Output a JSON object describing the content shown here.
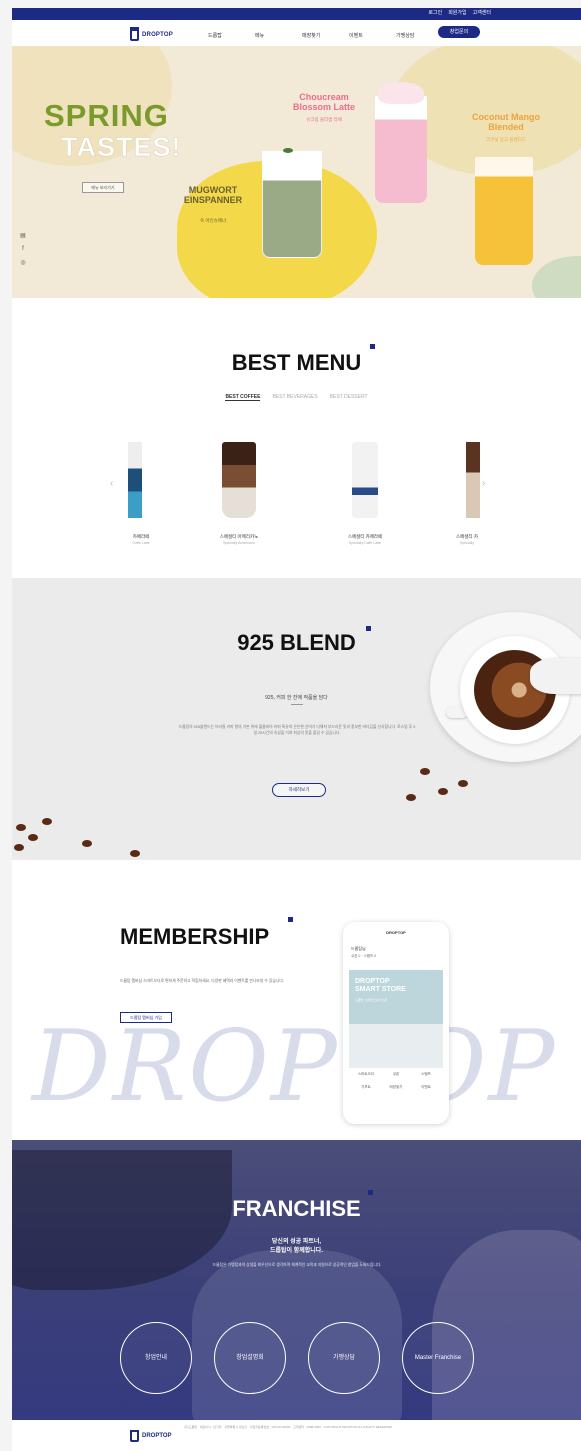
{
  "util": {
    "links": [
      "로그인",
      "회원가입",
      "고객센터"
    ]
  },
  "header": {
    "logo": "DROPTOP",
    "nav": [
      "드롭탑",
      "메뉴",
      "매장찾기",
      "이벤트",
      "가맹상담"
    ],
    "cta": "창업문의"
  },
  "hero": {
    "title1": "SPRING",
    "title2": "TASTES!",
    "more": "메뉴 보러가기",
    "drink1_name": "Choucream Blossom Latte",
    "drink1_sub": "슈크림 블라썸 라떼",
    "drink2_name": "Coconut Mango Blended",
    "drink2_sub": "코코넛 망고 블렌디드",
    "drink3_name": "MUGWORT EINSPANNER",
    "drink3_sub": "쑥 아인슈페너"
  },
  "social": [
    "blog-icon",
    "facebook-icon",
    "instagram-icon"
  ],
  "best_menu": {
    "title": "BEST MENU",
    "tabs": [
      "BEST COFFEE",
      "BEST BEVERAGES",
      "BEST DESSERT"
    ],
    "products": [
      {
        "name": "카페라떼",
        "en": "Caffe Latte"
      },
      {
        "name": "스페셜티 아메리카노",
        "en": "Specialty Americano"
      },
      {
        "name": "스페셜티 카페라떼",
        "en": "Specialty Caffe Latte"
      },
      {
        "name": "스페셜티 카",
        "en": "Specialty"
      }
    ]
  },
  "blend": {
    "title": "925 BLEND",
    "subtitle": "925, 커피 한 잔에 작품을 담다",
    "body": "드롭탑의 925블렌드는 브라질 커피 향의 기본 위에 콜롬비아 커피 특유의 은은한 산미가 더해져 부드러운 맛과 풍부한 바디감을 선사합니다. 로스팅 후 9일 25시간의 숙성을 거쳐 최상의 맛을 즐길 수 있습니다.",
    "button": "자세히보기"
  },
  "membership": {
    "title": "MEMBERSHIP",
    "body": "드롭탑 멤버십 스마트오더로 편하게 주문하고 적립하세요. 다양한 혜택과 이벤트를 만나보실 수 있습니다.",
    "button": "드롭탑 멤버십 가입",
    "script": "DROPTOP",
    "phone": {
      "top": "DROPTOP",
      "user": "드롭탑님",
      "stat": "쿠폰 0 · 스탬프 0",
      "banner1": "DROPTOP",
      "banner1b": "SMART STORE",
      "banner2": "드롭탑 스마트스토어 오픈",
      "menu": [
        "스마트오더",
        "쿠폰",
        "스탬프",
        "기프트",
        "매장찾기",
        "이벤트"
      ]
    }
  },
  "franchise": {
    "title": "FRANCHISE",
    "subtitle1": "당신의 성공 파트너,",
    "subtitle2": "드롭탑이 함께합니다.",
    "body": "드롭탑은 가맹점과의 상생을 최우선으로 생각하며 체계적인 교육과 지원으로 성공적인 창업을 도와드립니다.",
    "items": [
      "창업안내",
      "창업설명회",
      "가맹상담",
      "Master Franchise"
    ]
  },
  "footer": {
    "logo": "DROPTOP",
    "info": "(주)드롭탑 · 대표이사 : 남기천 · 서울특별시 강남구 · 사업자등록번호 : 000-00-00000 · 고객센터 : 1588-0000 · COPYRIGHT DROPTOP ALL RIGHTS RESERVED."
  },
  "colors": {
    "brand": "#1c2a86",
    "spring_green": "#7a9a2c"
  }
}
